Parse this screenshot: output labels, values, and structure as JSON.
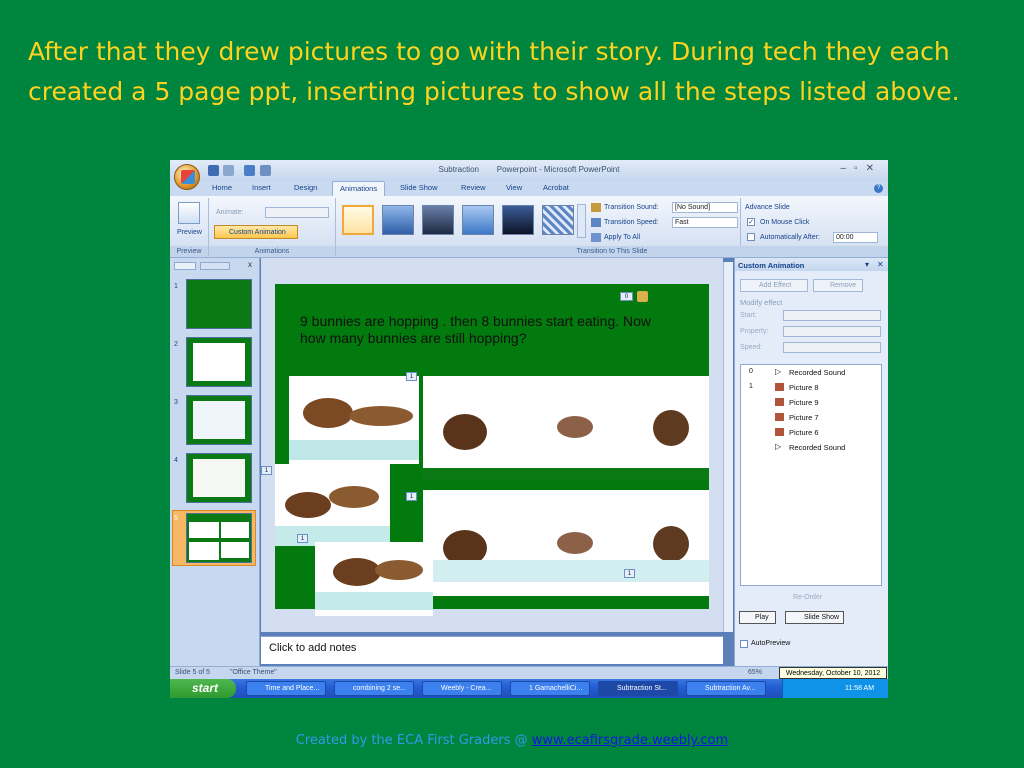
{
  "heading": "After that they drew pictures to go with their story.  During tech they each created a 5 page ppt, inserting pictures to show all the steps listed above.",
  "credit": {
    "prefix": "Created by the ECA First Graders @ ",
    "link": "www.ecafirsgrade.weebly.com"
  },
  "window": {
    "doc_name": "Subtraction",
    "app_title": "Powerpoint - Microsoft PowerPoint"
  },
  "tabs": [
    "Home",
    "Insert",
    "Design",
    "Animations",
    "Slide Show",
    "Review",
    "View",
    "Acrobat"
  ],
  "active_tab": "Animations",
  "ribbon": {
    "preview": "Preview",
    "animate_label": "Animate:",
    "custom_animation": "Custom Animation",
    "group_preview": "Preview",
    "group_animations": "Animations",
    "group_transition": "Transition to This Slide",
    "transition_sound_label": "Transition Sound:",
    "transition_sound_value": "[No Sound]",
    "transition_speed_label": "Transition Speed:",
    "transition_speed_value": "Fast",
    "apply_all": "Apply To All",
    "advance_slide": "Advance Slide",
    "on_mouse_click": "On Mouse Click",
    "auto_after": "Automatically After:",
    "auto_time": "00:00"
  },
  "slides": [
    "1",
    "2",
    "3",
    "4",
    "5"
  ],
  "slide_text": "9 bunnies are hopping . then 8 bunnies start eating. Now how many bunnies are still hopping?",
  "slide_tags": {
    "sound": "0",
    "pic": "1"
  },
  "notes_placeholder": "Click to add notes",
  "custom_animation": {
    "title": "Custom Animation",
    "add_effect": "Add Effect",
    "remove": "Remove",
    "modify_effect": "Modify effect",
    "start": "Start:",
    "property": "Property:",
    "speed": "Speed:",
    "items": [
      {
        "num": "0",
        "label": "Recorded Sound"
      },
      {
        "num": "1",
        "label": "Picture 8"
      },
      {
        "num": "",
        "label": "Picture 9"
      },
      {
        "num": "",
        "label": "Picture 7"
      },
      {
        "num": "",
        "label": "Picture 6"
      },
      {
        "num": "",
        "label": "Recorded Sound"
      }
    ],
    "reorder": "Re-Order",
    "play": "Play",
    "slide_show": "Slide Show",
    "autopreview": "AutoPreview"
  },
  "status": {
    "slide": "Slide 5 of 5",
    "theme": "\"Office Theme\"",
    "zoom": "65%"
  },
  "taskbar": {
    "start": "start",
    "items": [
      "Time and Place...",
      "combining 2 se...",
      "Weebly - Crea...",
      "1 GamachelliCi...",
      "Subtraction St...",
      "Subtraction Av..."
    ],
    "clock": "11:58 AM"
  },
  "tooltip": "Wednesday, October 10, 2012",
  "colors": {
    "background": "#00853f",
    "heading": "#ffd21f",
    "slide_bg": "#037a0d"
  }
}
